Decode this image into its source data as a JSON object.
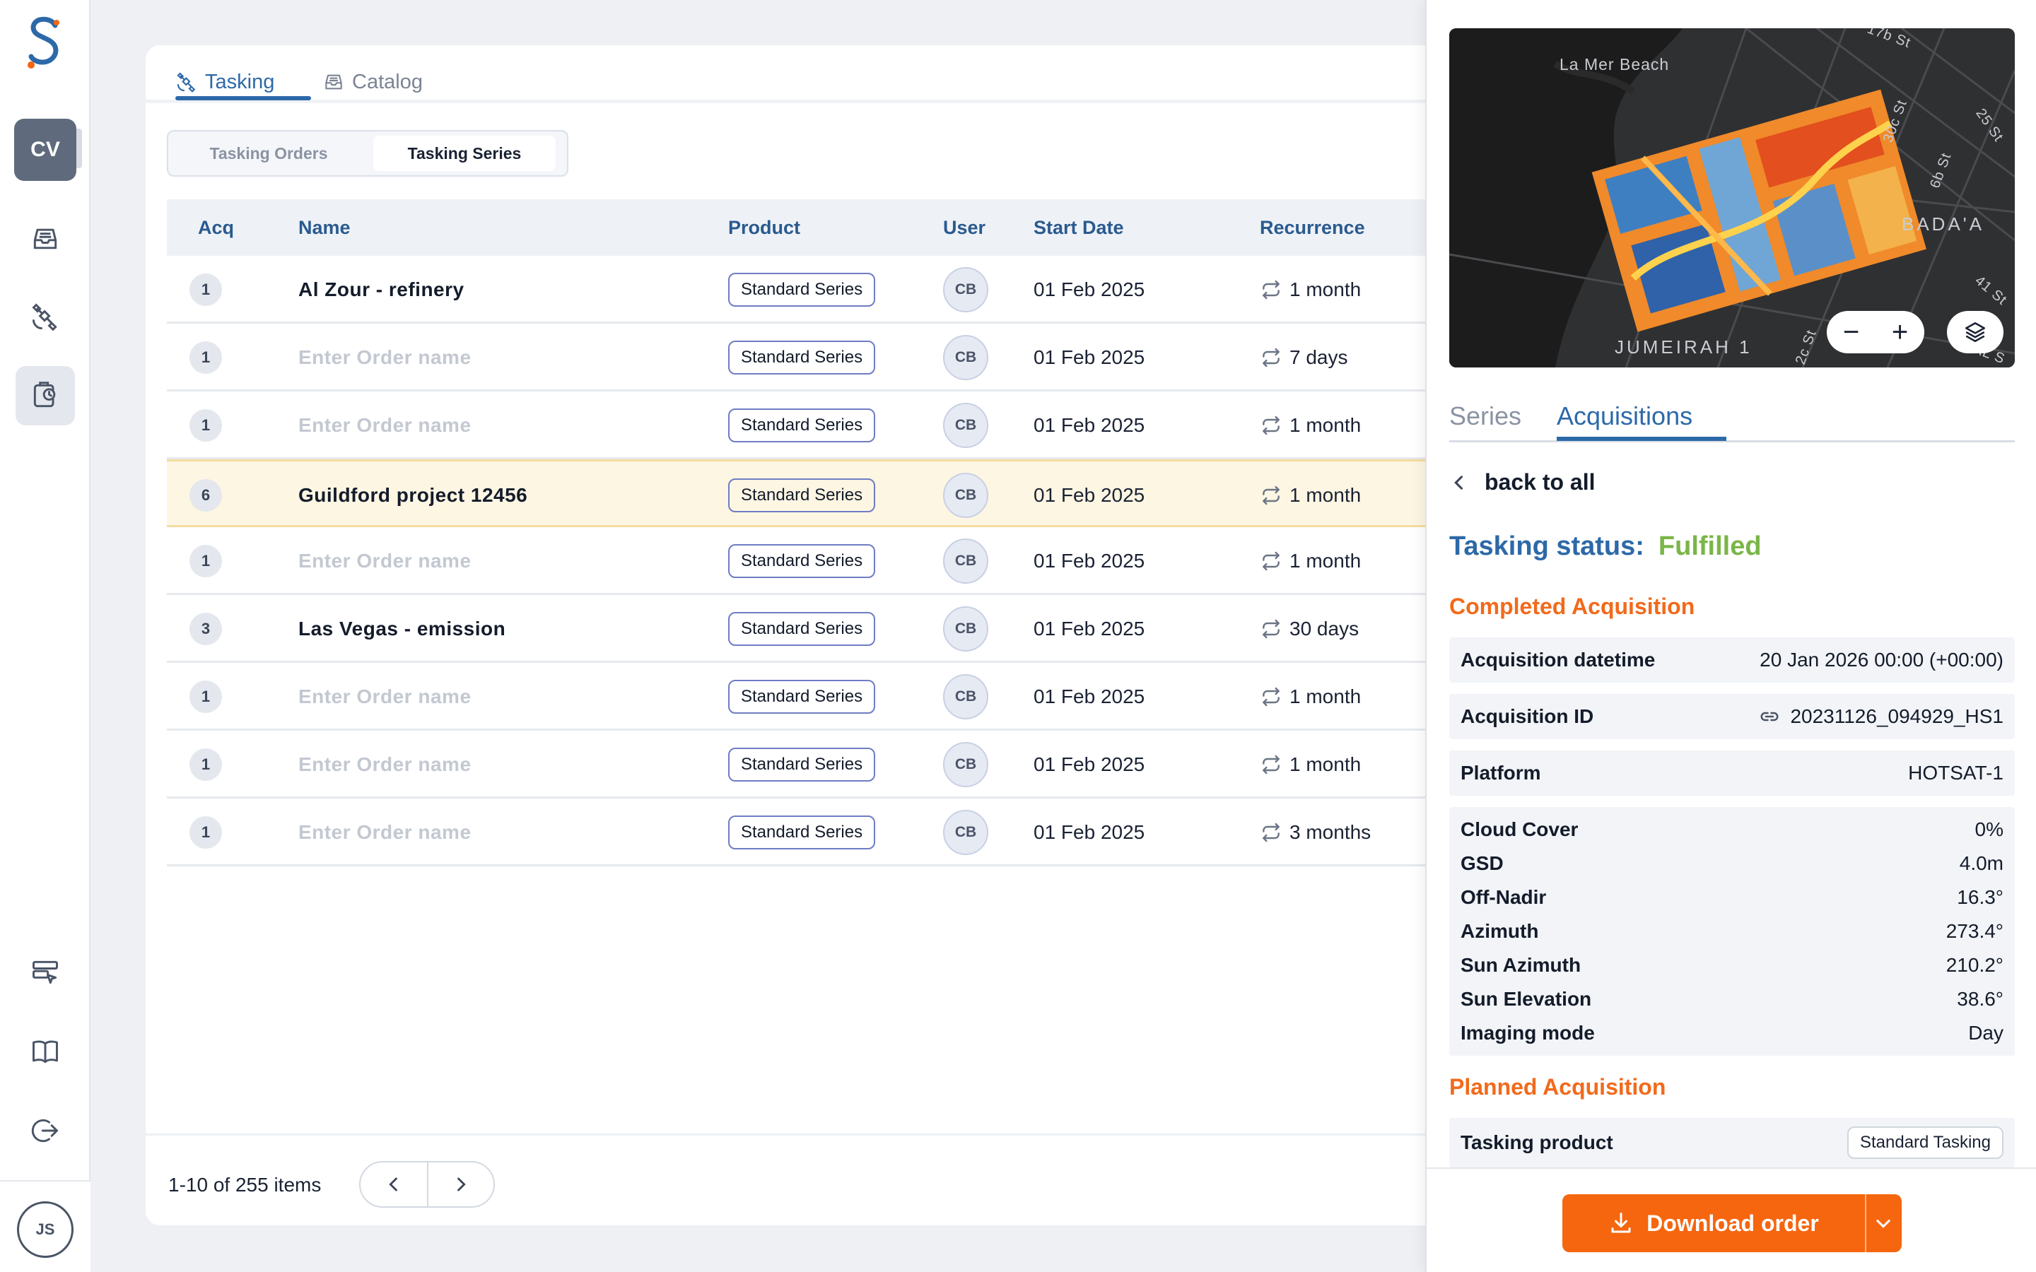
{
  "sidebar": {
    "workspace_initials": "CV",
    "user_initials": "JS"
  },
  "tabs": [
    {
      "label": "Tasking",
      "icon": "satellite-icon",
      "active": true
    },
    {
      "label": "Catalog",
      "icon": "inbox-icon",
      "active": false
    }
  ],
  "segment": {
    "options": [
      "Tasking Orders",
      "Tasking Series"
    ],
    "selected": "Tasking Series"
  },
  "table": {
    "columns": [
      "Acq",
      "Name",
      "Product",
      "User",
      "Start Date",
      "Recurrence"
    ],
    "rows": [
      {
        "acq": "1",
        "name": "Al Zour - refinery",
        "placeholder": false,
        "product": "Standard Series",
        "user": "CB",
        "start": "01 Feb 2025",
        "recurrence": "1 month",
        "highlight": false
      },
      {
        "acq": "1",
        "name": "Enter Order name",
        "placeholder": true,
        "product": "Standard Series",
        "user": "CB",
        "start": "01 Feb 2025",
        "recurrence": "7 days",
        "highlight": false
      },
      {
        "acq": "1",
        "name": "Enter Order name",
        "placeholder": true,
        "product": "Standard Series",
        "user": "CB",
        "start": "01 Feb 2025",
        "recurrence": "1 month",
        "highlight": false
      },
      {
        "acq": "6",
        "name": "Guildford project 12456",
        "placeholder": false,
        "product": "Standard Series",
        "user": "CB",
        "start": "01 Feb 2025",
        "recurrence": "1 month",
        "highlight": true
      },
      {
        "acq": "1",
        "name": "Enter Order name",
        "placeholder": true,
        "product": "Standard Series",
        "user": "CB",
        "start": "01 Feb 2025",
        "recurrence": "1 month",
        "highlight": false
      },
      {
        "acq": "3",
        "name": "Las Vegas - emission",
        "placeholder": false,
        "product": "Standard Series",
        "user": "CB",
        "start": "01 Feb 2025",
        "recurrence": "30 days",
        "highlight": false
      },
      {
        "acq": "1",
        "name": "Enter Order name",
        "placeholder": true,
        "product": "Standard Series",
        "user": "CB",
        "start": "01 Feb 2025",
        "recurrence": "1 month",
        "highlight": false
      },
      {
        "acq": "1",
        "name": "Enter Order name",
        "placeholder": true,
        "product": "Standard Series",
        "user": "CB",
        "start": "01 Feb 2025",
        "recurrence": "1 month",
        "highlight": false
      },
      {
        "acq": "1",
        "name": "Enter Order name",
        "placeholder": true,
        "product": "Standard Series",
        "user": "CB",
        "start": "01 Feb 2025",
        "recurrence": "3 months",
        "highlight": false
      }
    ]
  },
  "pagination": {
    "summary": "1-10 of 255 items"
  },
  "map": {
    "labels": [
      "La Mer Beach",
      "BADA'A",
      "JUMEIRAH 1",
      "25 St",
      "30c St",
      "6b St",
      "41 St",
      "17b St",
      "2c St",
      "AL S"
    ],
    "zoom_out": "−",
    "zoom_in": "+"
  },
  "panel": {
    "tabs": [
      "Series",
      "Acquisitions"
    ],
    "active_tab": "Acquisitions",
    "back_label": "back to all",
    "status_label": "Tasking status:",
    "status_value": "Fulfilled",
    "completed_title": "Completed Acquisition",
    "acq_datetime": {
      "key": "Acquisition datetime",
      "value": "20 Jan 2026 00:00 (+00:00)"
    },
    "acq_id": {
      "key": "Acquisition ID",
      "value": "20231126_094929_HS1"
    },
    "platform": {
      "key": "Platform",
      "value": "HOTSAT-1"
    },
    "details": [
      {
        "key": "Cloud Cover",
        "value": "0%"
      },
      {
        "key": "GSD",
        "value": "4.0m"
      },
      {
        "key": "Off-Nadir",
        "value": "16.3°"
      },
      {
        "key": "Azimuth",
        "value": "273.4°"
      },
      {
        "key": "Sun Azimuth",
        "value": "210.2°"
      },
      {
        "key": "Sun Elevation",
        "value": "38.6°"
      },
      {
        "key": "Imaging mode",
        "value": "Day"
      }
    ],
    "planned_title": "Planned Acquisition",
    "tasking_product": {
      "key": "Tasking product",
      "value": "Standard Tasking"
    },
    "download_label": "Download order"
  },
  "colors": {
    "accent_blue": "#2d69a8",
    "accent_orange": "#f5660f",
    "success_green": "#7ab648",
    "highlight_row": "#fdf6e3"
  }
}
